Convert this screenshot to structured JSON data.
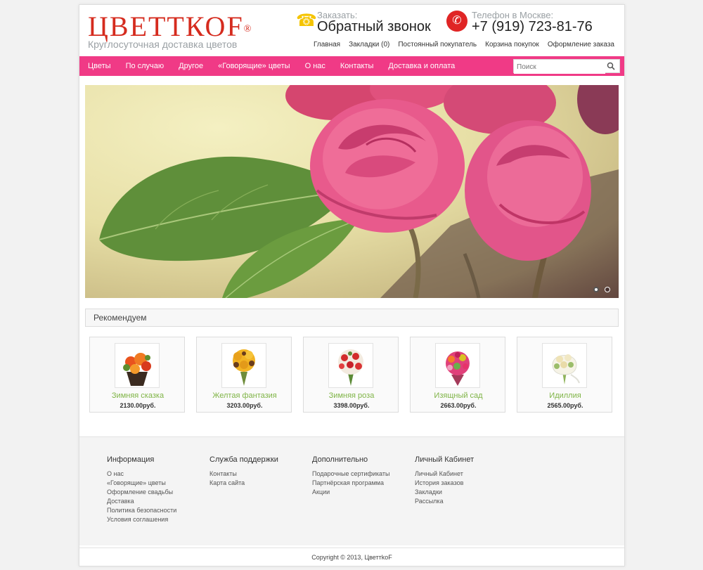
{
  "header": {
    "logo_text": "ЦВЕТТКОF",
    "logo_reg": "®",
    "tagline": "Круглосуточная доставка цветов",
    "callback_label": "Заказать:",
    "callback_title": "Обратный звонок",
    "phone_label": "Телефон в Москве:",
    "phone_number": "+7 (919) 723-81-76",
    "top_links": [
      "Главная",
      "Закладки (0)",
      "Постоянный покупатель",
      "Корзина покупок",
      "Оформление заказа"
    ]
  },
  "nav": {
    "items": [
      "Цветы",
      "По случаю",
      "Другое",
      "«Говорящие» цветы",
      "О нас",
      "Контакты",
      "Доставка и оплата"
    ],
    "search_placeholder": "Поиск"
  },
  "slider": {
    "slides": 2,
    "active_slide": 1
  },
  "recommend": {
    "title": "Рекомендуем",
    "products": [
      {
        "name": "Зимняя сказка",
        "price": "2130.00руб."
      },
      {
        "name": "Желтая фантазия",
        "price": "3203.00руб."
      },
      {
        "name": "Зимняя роза",
        "price": "3398.00руб."
      },
      {
        "name": "Изящный сад",
        "price": "2663.00руб."
      },
      {
        "name": "Идиллия",
        "price": "2565.00руб."
      }
    ]
  },
  "footer": {
    "columns": [
      {
        "title": "Информация",
        "links": [
          "О нас",
          "«Говорящие» цветы",
          "Оформление свадьбы",
          "Доставка",
          "Политика безопасности",
          "Условия соглашения"
        ]
      },
      {
        "title": "Служба поддержки",
        "links": [
          "Контакты",
          "Карта сайта"
        ]
      },
      {
        "title": "Дополнительно",
        "links": [
          "Подарочные сертификаты",
          "Партнёрская программа",
          "Акции"
        ]
      },
      {
        "title": "Личный Кабинет",
        "links": [
          "Личный Кабинет",
          "История заказов",
          "Закладки",
          "Рассылка"
        ]
      }
    ],
    "copyright": "Copyright © 2013, ЦветтkoF"
  },
  "colors": {
    "brand_red": "#d52b1e",
    "nav_pink": "#f03a86",
    "product_link_green": "#7fb446"
  }
}
